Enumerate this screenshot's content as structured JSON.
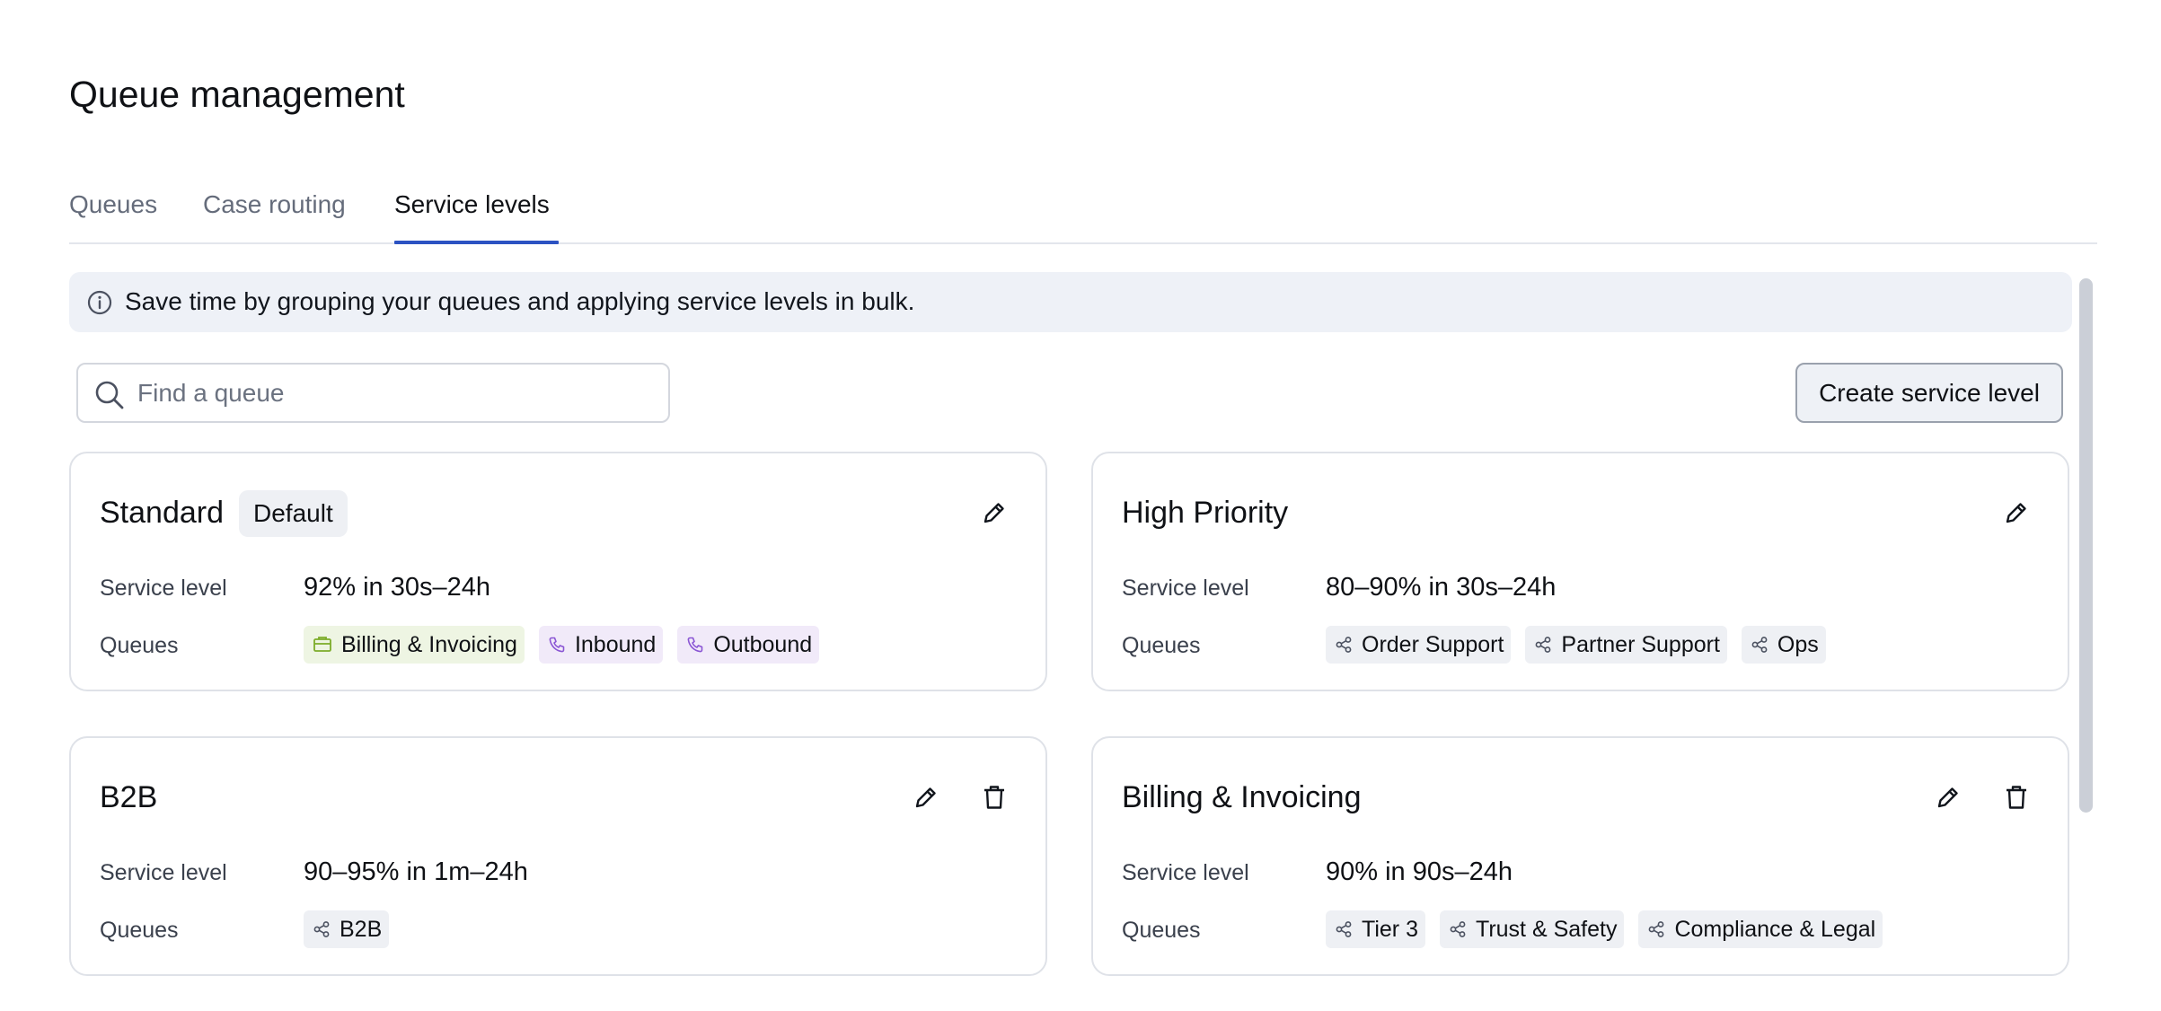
{
  "page_title": "Queue management",
  "tabs": [
    {
      "label": "Queues",
      "active": false
    },
    {
      "label": "Case routing",
      "active": false
    },
    {
      "label": "Service levels",
      "active": true
    }
  ],
  "banner": {
    "text": "Save time by grouping your queues and applying service levels in bulk.",
    "icon": "info-icon"
  },
  "search": {
    "placeholder": "Find a queue",
    "value": "",
    "icon": "search-icon"
  },
  "create_button": "Create service level",
  "labels": {
    "service_level": "Service level",
    "queues": "Queues"
  },
  "cards": [
    {
      "title": "Standard",
      "badge": "Default",
      "service_level": "92% in 30s–24h",
      "actions": [
        "pencil-icon"
      ],
      "queues": [
        {
          "name": "Billing & Invoicing",
          "icon": "envelope-icon",
          "tint": "green"
        },
        {
          "name": "Inbound",
          "icon": "phone-icon",
          "tint": "purple"
        },
        {
          "name": "Outbound",
          "icon": "phone-icon",
          "tint": "purple"
        }
      ]
    },
    {
      "title": "High Priority",
      "badge": "",
      "service_level": "80–90% in 30s–24h",
      "actions": [
        "pencil-icon"
      ],
      "queues": [
        {
          "name": "Order Support",
          "icon": "share-icon",
          "tint": "gray"
        },
        {
          "name": "Partner Support",
          "icon": "share-icon",
          "tint": "gray"
        },
        {
          "name": "Ops",
          "icon": "share-icon",
          "tint": "gray"
        }
      ]
    },
    {
      "title": "B2B",
      "badge": "",
      "service_level": "90–95% in 1m–24h",
      "actions": [
        "pencil-icon",
        "trash-icon"
      ],
      "queues": [
        {
          "name": "B2B",
          "icon": "share-icon",
          "tint": "gray"
        }
      ]
    },
    {
      "title": "Billing & Invoicing",
      "badge": "",
      "service_level": "90% in 90s–24h",
      "actions": [
        "pencil-icon",
        "trash-icon"
      ],
      "queues": [
        {
          "name": "Tier 3",
          "icon": "share-icon",
          "tint": "gray"
        },
        {
          "name": "Trust & Safety",
          "icon": "share-icon",
          "tint": "gray"
        },
        {
          "name": "Compliance & Legal",
          "icon": "share-icon",
          "tint": "gray"
        }
      ]
    }
  ],
  "colors": {
    "accent": "#2c52c2",
    "banner_bg": "#eef1f7",
    "chip_green": "#eef5e3",
    "chip_purple": "#f1eaf9",
    "chip_gray": "#eef0f4"
  }
}
